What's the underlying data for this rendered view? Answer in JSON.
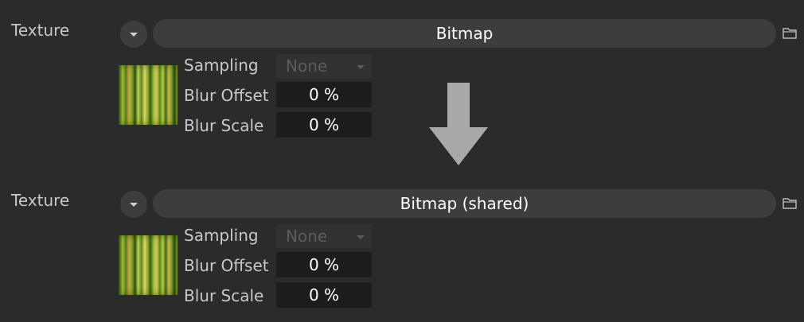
{
  "panels": [
    {
      "texture_label": "Texture",
      "shader_name": "Bitmap",
      "sampling_label": "Sampling",
      "sampling_value": "None",
      "blur_offset_label": "Blur Offset",
      "blur_offset_value": "0 %",
      "blur_scale_label": "Blur Scale",
      "blur_scale_value": "0 %"
    },
    {
      "texture_label": "Texture",
      "shader_name": "Bitmap (shared)",
      "sampling_label": "Sampling",
      "sampling_value": "None",
      "blur_offset_label": "Blur Offset",
      "blur_offset_value": "0 %",
      "blur_scale_label": "Blur Scale",
      "blur_scale_value": "0 %"
    }
  ],
  "icons": {
    "dropdown": "chevron-down-icon",
    "folder": "folder-icon",
    "transition": "arrow-down-icon"
  },
  "colors": {
    "background": "#2b2b2b",
    "control": "#3d3d3d",
    "field": "#1c1c1c",
    "arrow": "#a9a9a9"
  }
}
